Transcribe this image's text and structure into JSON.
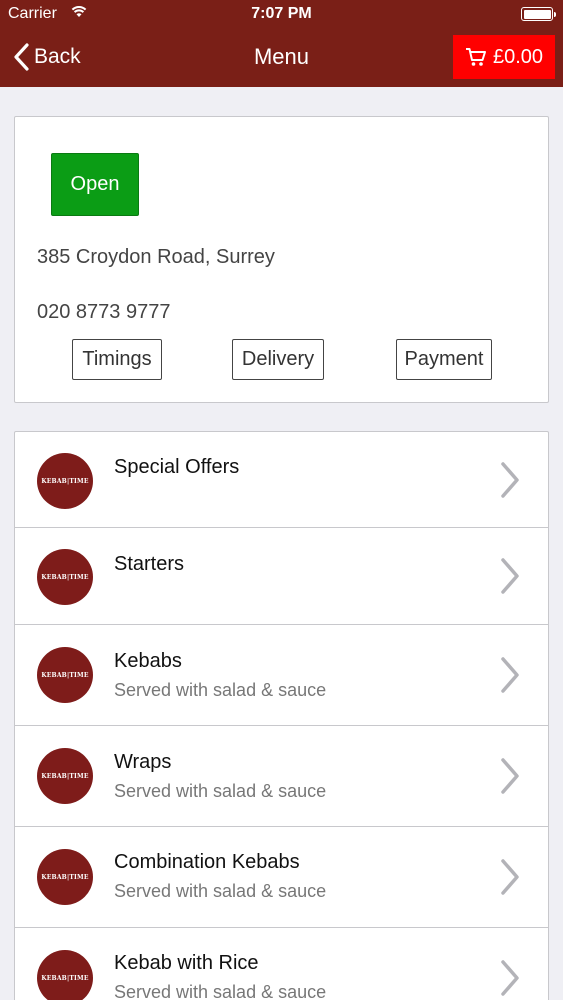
{
  "status_bar": {
    "carrier": "Carrier",
    "time": "7:07 PM"
  },
  "nav": {
    "back_label": "Back",
    "title": "Menu",
    "cart_total": "£0.00"
  },
  "info": {
    "status_label": "Open",
    "address": "385 Croydon Road, Surrey",
    "phone": "020 8773 9777",
    "buttons": {
      "timings": "Timings",
      "delivery": "Delivery",
      "payment": "Payment"
    }
  },
  "menu": {
    "items": [
      {
        "name": "Special Offers",
        "desc": ""
      },
      {
        "name": "Starters",
        "desc": ""
      },
      {
        "name": "Kebabs",
        "desc": "Served with salad & sauce"
      },
      {
        "name": "Wraps",
        "desc": "Served with salad & sauce"
      },
      {
        "name": "Combination Kebabs",
        "desc": "Served with salad & sauce"
      },
      {
        "name": "Kebab with Rice",
        "desc": "Served with salad & sauce"
      }
    ]
  },
  "colors": {
    "nav_bar": "#7a1f17",
    "cart_button": "#ff0000",
    "open_button": "#0b9d15",
    "logo_bg": "#7e1c1a"
  },
  "icons": {
    "back": "chevron-left-icon",
    "cart": "cart-icon",
    "row": "chevron-right-icon",
    "wifi": "wifi-icon",
    "battery": "battery-icon"
  }
}
